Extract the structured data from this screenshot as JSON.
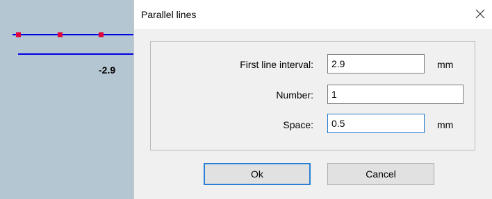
{
  "canvas": {
    "value_label": "-2.9"
  },
  "dialog": {
    "title": "Parallel lines",
    "fields": [
      {
        "label": "First line interval:",
        "value": "2.9",
        "unit": "mm"
      },
      {
        "label": "Number:",
        "value": "1",
        "unit": ""
      },
      {
        "label": "Space:",
        "value": "0.5",
        "unit": "mm"
      }
    ],
    "buttons": {
      "ok": "Ok",
      "cancel": "Cancel"
    }
  },
  "colors": {
    "line": "#0000e6",
    "handle": "#e0003a",
    "canvas_bg": "#b5c6d3",
    "focus": "#1e76c8"
  }
}
